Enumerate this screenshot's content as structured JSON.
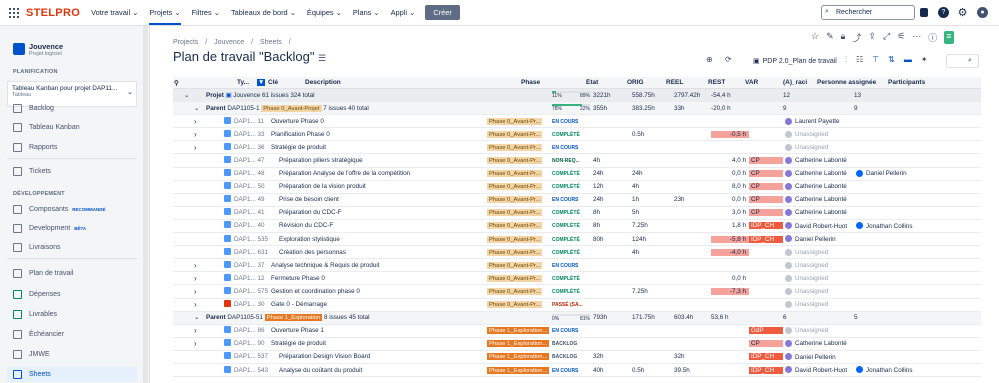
{
  "topnav": {
    "logo": "STELPRO",
    "items": [
      "Votre travail ⌄",
      "Projets ⌄",
      "Filtres ⌄",
      "Tableaux de bord ⌄",
      "Équipes ⌄",
      "Plans ⌄",
      "Appli ⌄"
    ],
    "create": "Créer",
    "search_placeholder": "Rechercher"
  },
  "sidebar": {
    "project_name": "Jouvence",
    "project_type": "Projet logiciel",
    "planning_label": "PLANIFICATION",
    "kanban_title": "Tableau Kanban pour projet DAP11...",
    "kanban_sub": "Tableau",
    "items_top": [
      "Backlog",
      "Tableau Kanban",
      "Rapports"
    ],
    "tickets": "Tickets",
    "dev_label": "DÉVELOPPEMENT",
    "components": "Composants",
    "components_badge": "RECOMMANDÉ",
    "development": "Development",
    "development_badge": "BÊTA",
    "releases": "Livraisons",
    "items_bottom": [
      "Plan de travail",
      "Dépenses",
      "Livrables",
      "Échéancier",
      "JMWE",
      "Sheets"
    ]
  },
  "main": {
    "breadcrumb": [
      "Projects",
      "/",
      "Jouvence",
      "/",
      "Sheets",
      "/"
    ],
    "title": "Plan de travail \"Backlog\"",
    "pdp": "PDP 2.0_Plan de travail"
  },
  "table": {
    "headers": [
      "Ty...",
      "Clé",
      "Description",
      "Phase",
      "État",
      "ORIG",
      "RÉEL",
      "REST",
      "VAR",
      "(A)_raci",
      "Personne assignée",
      "Participants"
    ],
    "project_row": {
      "label": "Projet",
      "key": "Jouvence",
      "issues": "61 issues",
      "total": "324 total",
      "p1": "11%",
      "p2": "89%",
      "orig": "3221h",
      "reel": "558.75h",
      "rest": "2797.42h",
      "var": "-54,4 h",
      "assigned": "12",
      "participants": "13"
    },
    "parent0": {
      "label": "Parent",
      "key": "DAP1105-1",
      "phase": "Phase 0_Avant-Projet",
      "issues": "7 issues",
      "total": "40 total",
      "p1": "78%",
      "p2": "22%",
      "orig": "355h",
      "reel": "383.25h",
      "rest": "33h",
      "var": "-20,0 h",
      "assigned": "9",
      "participants": "9"
    },
    "rows0": [
      {
        "key": "DAP1... 11",
        "desc": "Ouverture Phase 0",
        "phase": "Phase 0_Avant-Pr...",
        "state": "EN COURS",
        "cls": "enc",
        "orig": "",
        "reel": "",
        "rest": "",
        "var": "",
        "raci": "",
        "person": "Laurent Payette",
        "part": "",
        "lvl": 1
      },
      {
        "key": "DAP1... 33",
        "desc": "Planification Phase 0",
        "phase": "Phase 0_Avant-Pr...",
        "state": "COMPLÉTÉ",
        "cls": "cmp",
        "orig": "",
        "reel": "0.5h",
        "rest": "",
        "var": "-0,5 h",
        "raci": "",
        "person": "Unassigned",
        "part": "",
        "lvl": 1
      },
      {
        "key": "DAP1... 36",
        "desc": "Stratégie de produit",
        "phase": "Phase 0_Avant-Pr...",
        "state": "EN COURS",
        "cls": "enc",
        "orig": "",
        "reel": "",
        "rest": "",
        "var": "",
        "raci": "",
        "person": "Unassigned",
        "part": "",
        "lvl": 1
      },
      {
        "key": "DAP1... 47",
        "desc": "Préparation piliers stratégique",
        "phase": "Phase 0_Avant-Pr...",
        "state": "NON-REQ...",
        "cls": "nrq",
        "orig": "4h",
        "reel": "",
        "rest": "",
        "var": "4,0 h",
        "raci": "CP",
        "person": "Catherine Labonté",
        "part": "",
        "lvl": 2
      },
      {
        "key": "DAP1... 48",
        "desc": "Préparation Analyse de l'offre de la compétition",
        "phase": "Phase 0_Avant-Pr...",
        "state": "COMPLÉTÉ",
        "cls": "cmp",
        "orig": "24h",
        "reel": "24h",
        "rest": "",
        "var": "0,0 h",
        "raci": "CP",
        "person": "Catherine Labonté",
        "part": "Daniel Pellerin",
        "lvl": 2
      },
      {
        "key": "DAP1... 50",
        "desc": "Préparation de la vision produit",
        "phase": "Phase 0_Avant-Pr...",
        "state": "COMPLÉTÉ",
        "cls": "cmp",
        "orig": "12h",
        "reel": "4h",
        "rest": "",
        "var": "8,0 h",
        "raci": "CP",
        "person": "Catherine Labonté",
        "part": "",
        "lvl": 2
      },
      {
        "key": "DAP1... 49",
        "desc": "Prise de besoin client",
        "phase": "Phase 0_Avant-Pr...",
        "state": "EN COURS",
        "cls": "enc",
        "orig": "24h",
        "reel": "1h",
        "rest": "23h",
        "var": "0,0 h",
        "raci": "CP",
        "person": "Catherine Labonté",
        "part": "",
        "lvl": 2
      },
      {
        "key": "DAP1... 41",
        "desc": "Préparation du CDC-F",
        "phase": "Phase 0_Avant-Pr...",
        "state": "COMPLÉTÉ",
        "cls": "cmp",
        "orig": "8h",
        "reel": "5h",
        "rest": "",
        "var": "3,0 h",
        "raci": "CP",
        "person": "Catherine Labonté",
        "part": "",
        "lvl": 2
      },
      {
        "key": "DAP1... 40",
        "desc": "Révision du CDC-F",
        "phase": "Phase 0_Avant-Pr...",
        "state": "COMPLÉTÉ",
        "cls": "cmp",
        "orig": "8h",
        "reel": "7.25h",
        "rest": "",
        "var": "1,8 h",
        "raci": "IDP_CH",
        "person": "David Robert-Huot",
        "part": "Jonathan Collins",
        "lvl": 2
      },
      {
        "key": "DAP1... 535",
        "desc": "Exploration stylistique",
        "phase": "Phase 0_Avant-Pr...",
        "state": "COMPLÉTÉ",
        "cls": "cmp",
        "orig": "80h",
        "reel": "124h",
        "rest": "",
        "var": "-5,8 h",
        "raci": "IDP_CH",
        "person": "Daniel Pellerin",
        "part": "",
        "lvl": 2
      },
      {
        "key": "DAP1... 631",
        "desc": "Création des personnas",
        "phase": "Phase 0_Avant-Pr...",
        "state": "COMPLÉTÉ",
        "cls": "cmp",
        "orig": "",
        "reel": "4h",
        "rest": "",
        "var": "-4,0 h",
        "raci": "",
        "person": "Unassigned",
        "part": "",
        "lvl": 2
      },
      {
        "key": "DAP1... 37",
        "desc": "Analyse technique & Requis de produit",
        "phase": "Phase 0_Avant-Pr...",
        "state": "EN COURS",
        "cls": "enc",
        "orig": "",
        "reel": "",
        "rest": "",
        "var": "",
        "raci": "",
        "person": "Unassigned",
        "part": "",
        "lvl": 1
      },
      {
        "key": "DAP1... 12",
        "desc": "Fermeture Phase 0",
        "phase": "Phase 0_Avant-Pr...",
        "state": "COMPLÉTÉ",
        "cls": "cmp",
        "orig": "",
        "reel": "",
        "rest": "",
        "var": "0,0 h",
        "raci": "",
        "person": "Unassigned",
        "part": "",
        "lvl": 1
      },
      {
        "key": "DAP1... 575",
        "desc": "Gestion et coordination phase 0",
        "phase": "Phase 0_Avant-Pr...",
        "state": "COMPLÉTÉ",
        "cls": "cmp",
        "orig": "",
        "reel": "7.25h",
        "rest": "",
        "var": "-7,3 h",
        "raci": "",
        "person": "Unassigned",
        "part": "",
        "lvl": 1
      },
      {
        "key": "DAP1... 30",
        "desc": "Gate 0 - Démarrage",
        "phase": "Phase 0_Avant-Pr...",
        "state": "PASSÉ (SA...",
        "cls": "pas",
        "orig": "",
        "reel": "",
        "rest": "",
        "var": "",
        "raci": "",
        "person": "Unassigned",
        "part": "",
        "lvl": 1
      }
    ],
    "parent1": {
      "label": "Parent",
      "key": "DAP1105-51",
      "phase": "Phase 1_Exploration",
      "issues": "8 issues",
      "total": "45 total",
      "p1": "0%",
      "p2": "81%",
      "orig": "793h",
      "reel": "171.75h",
      "rest": "603.4h",
      "var": "53,6 h",
      "assigned": "6",
      "participants": "5"
    },
    "rows1": [
      {
        "key": "DAP1... 86",
        "desc": "Ouverture Phase 1",
        "phase": "Phase 1_Exploration...",
        "state": "EN COURS",
        "cls": "enc",
        "orig": "",
        "reel": "",
        "rest": "",
        "var": "",
        "raci": "GdP",
        "person": "Unassigned",
        "part": "",
        "lvl": 1
      },
      {
        "key": "DAP1... 90",
        "desc": "Stratégie de produit",
        "phase": "Phase 1_Exploration...",
        "state": "BACKLOG",
        "cls": "bkl",
        "orig": "",
        "reel": "",
        "rest": "",
        "var": "",
        "raci": "CP",
        "person": "Catherine Labonté",
        "part": "",
        "lvl": 1
      },
      {
        "key": "DAP1... 537",
        "desc": "Préparation Design Vision Board",
        "phase": "Phase 1_Exploration...",
        "state": "BACKLOG",
        "cls": "bkl",
        "orig": "32h",
        "reel": "",
        "rest": "32h",
        "var": "",
        "raci": "IDP_CH",
        "person": "Daniel Pellerin",
        "part": "",
        "lvl": 2
      },
      {
        "key": "DAP1... 543",
        "desc": "Analyse du coûtant du produit",
        "phase": "Phase 1_Exploration...",
        "state": "EN COURS",
        "cls": "enc",
        "orig": "40h",
        "reel": "0.5h",
        "rest": "39.5h",
        "var": "",
        "raci": "IDP_CH",
        "person": "David Robert-Huot",
        "part": "Jonathan Collins",
        "lvl": 2
      }
    ]
  }
}
